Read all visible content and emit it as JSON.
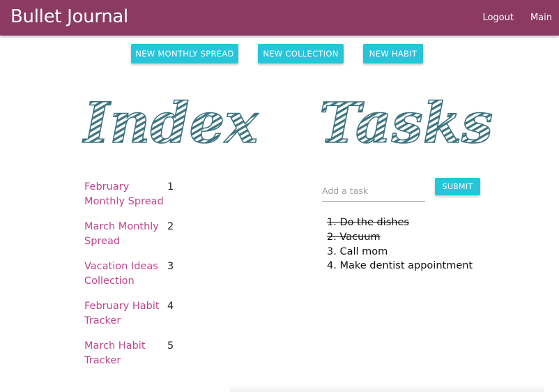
{
  "navbar": {
    "brand": "Bullet Journal",
    "links": [
      "Logout",
      "Main"
    ]
  },
  "actions": {
    "new_monthly": "NEW MONTHLY SPREAD",
    "new_collection": "NEW COLLECTION",
    "new_habit": "NEW HABIT"
  },
  "index": {
    "title": "Index",
    "entries": [
      {
        "name": "February Monthly Spread",
        "page": "1"
      },
      {
        "name": "March Monthly Spread",
        "page": "2"
      },
      {
        "name": "Vacation Ideas Collection",
        "page": "3"
      },
      {
        "name": "February Habit Tracker",
        "page": "4"
      },
      {
        "name": "March Habit Tracker",
        "page": "5"
      }
    ]
  },
  "tasks": {
    "title": "Tasks",
    "input_placeholder": "Add a task",
    "input_value": "",
    "submit_label": "SUBMIT",
    "items": [
      {
        "text": "1. Do the dishes",
        "done": true
      },
      {
        "text": "2. Vacuum",
        "done": true
      },
      {
        "text": "3. Call mom",
        "done": false
      },
      {
        "text": "4. Make dentist appointment",
        "done": false
      }
    ]
  },
  "colors": {
    "navbar": "#8c3a62",
    "accent": "#26c6da",
    "link": "#c2448c",
    "heading": "#3d7480"
  }
}
